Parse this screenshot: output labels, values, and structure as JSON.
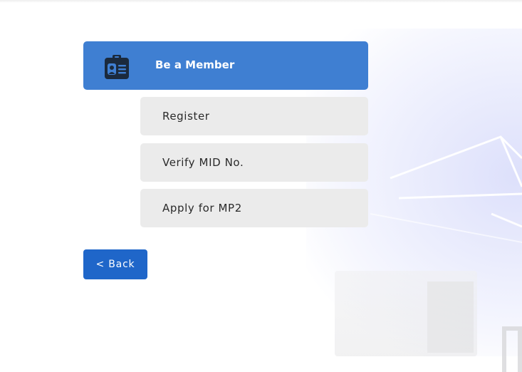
{
  "header": {
    "title": "Be a Member",
    "icon": "id-badge-icon",
    "background_color": "#3f7fd2"
  },
  "menu": {
    "items": [
      {
        "label": "Register"
      },
      {
        "label": "Verify MID No."
      },
      {
        "label": "Apply for MP2"
      }
    ],
    "item_background_color": "#ebebeb"
  },
  "back_button": {
    "label": "< Back",
    "background_color": "#1f66c9"
  }
}
